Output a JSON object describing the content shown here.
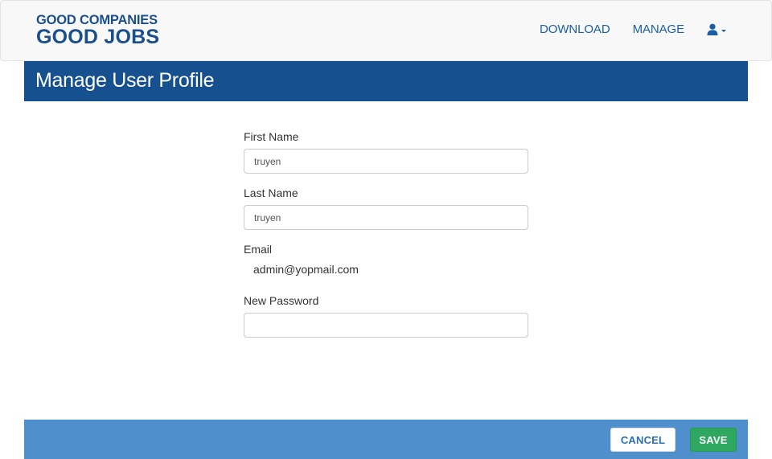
{
  "brand": {
    "line1": "GOOD COMPANIES",
    "line2": "GOOD JOBS",
    "color": "#1b4f8c"
  },
  "nav": {
    "download_label": "DOWNLOAD",
    "manage_label": "MANAGE",
    "user_icon": "user-icon",
    "link_color": "#1b5fa3"
  },
  "header": {
    "title": "Manage User Profile",
    "background": "#16508f"
  },
  "form": {
    "first_name": {
      "label": "First Name",
      "value": "truyen"
    },
    "last_name": {
      "label": "Last Name",
      "value": "truyen"
    },
    "email": {
      "label": "Email",
      "value": "admin@yopmail.com"
    },
    "new_password": {
      "label": "New Password",
      "value": ""
    }
  },
  "footer": {
    "cancel_label": "CANCEL",
    "save_label": "SAVE",
    "background": "#4f8fcb",
    "save_color": "#2ea760"
  }
}
